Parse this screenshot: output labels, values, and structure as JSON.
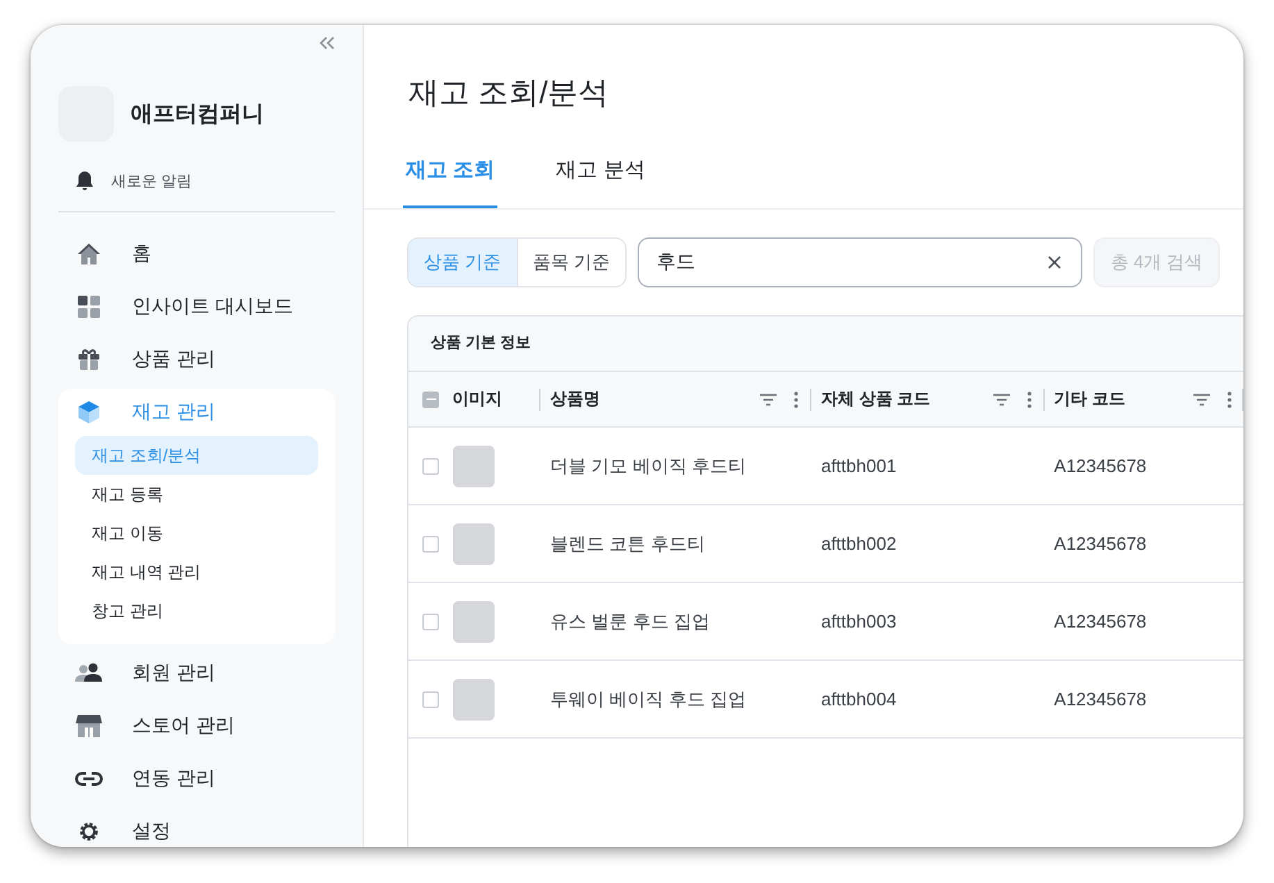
{
  "sidebar": {
    "company": "애프터컴퍼니",
    "notification": "새로운 알림",
    "items": [
      {
        "label": "홈",
        "selected": false,
        "expanded": false
      },
      {
        "label": "인사이트 대시보드",
        "selected": false,
        "expanded": false
      },
      {
        "label": "상품 관리",
        "selected": false,
        "expanded": false
      },
      {
        "label": "재고 관리",
        "selected": true,
        "expanded": true,
        "children": [
          {
            "label": "재고 조회/분석",
            "selected": true
          },
          {
            "label": "재고 등록",
            "selected": false
          },
          {
            "label": "재고 이동",
            "selected": false
          },
          {
            "label": "재고 내역 관리",
            "selected": false
          },
          {
            "label": "창고 관리",
            "selected": false
          }
        ]
      },
      {
        "label": "회원 관리",
        "selected": false,
        "expanded": false
      },
      {
        "label": "스토어 관리",
        "selected": false,
        "expanded": false
      },
      {
        "label": "연동 관리",
        "selected": false,
        "expanded": false
      },
      {
        "label": "설정",
        "selected": false,
        "expanded": false
      }
    ]
  },
  "page": {
    "title": "재고 조회/분석"
  },
  "tabs": [
    {
      "label": "재고 조회",
      "selected": true
    },
    {
      "label": "재고 분석",
      "selected": false
    }
  ],
  "filter": {
    "toggle": [
      {
        "label": "상품 기준",
        "selected": true
      },
      {
        "label": "품목 기준",
        "selected": false
      }
    ],
    "search": {
      "value": "후드"
    },
    "button": {
      "label": "총 4개 검색",
      "disabled": true
    }
  },
  "table": {
    "group_header": "상품 기본 정보",
    "select_all": {
      "indeterminate": true
    },
    "columns": [
      {
        "label": "이미지",
        "kind": "plain"
      },
      {
        "label": "상품명",
        "kind": "tools"
      },
      {
        "label": "자체 상품 코드",
        "kind": "tools"
      },
      {
        "label": "기타 코드",
        "kind": "tools"
      }
    ],
    "rows": [
      {
        "checked": false,
        "name": "더블 기모 베이직 후드티",
        "code": "afttbh001",
        "other_code": "A12345678"
      },
      {
        "checked": false,
        "name": "블렌드 코튼 후드티",
        "code": "afttbh002",
        "other_code": "A12345678"
      },
      {
        "checked": false,
        "name": "유스 벌룬 후드 집업",
        "code": "afttbh003",
        "other_code": "A12345678"
      },
      {
        "checked": false,
        "name": "투웨이 베이직 후드 집업",
        "code": "afttbh004",
        "other_code": "A12345678"
      }
    ]
  }
}
